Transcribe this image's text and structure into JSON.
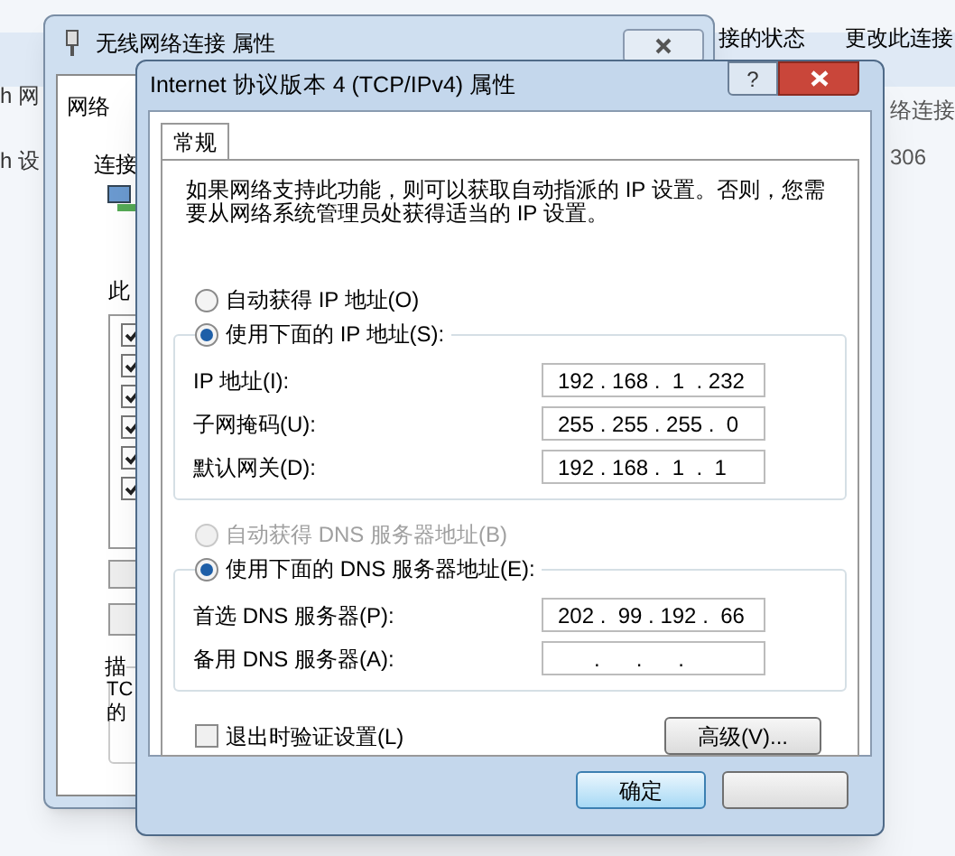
{
  "background": {
    "left_texts": [
      "h 网",
      "h 设"
    ],
    "right_texts": [
      "接的状态",
      "更改此连接"
    ],
    "right_lines": [
      "络连接",
      "306"
    ]
  },
  "back_dialog": {
    "title": "无线网络连接 属性",
    "tab": "网络",
    "labels": [
      "连接",
      "此"
    ],
    "items": [
      {
        "checked": true
      },
      {
        "checked": true
      },
      {
        "checked": true
      },
      {
        "checked": true
      },
      {
        "checked": true
      },
      {
        "checked": true
      }
    ],
    "group_title": "描",
    "group_lines": [
      "TC",
      "的"
    ]
  },
  "dialog": {
    "title": "Internet 协议版本 4 (TCP/IPv4) 属性",
    "help": "?",
    "tabs": [
      {
        "label": "常规",
        "selected": true
      }
    ],
    "description": "如果网络支持此功能，则可以获取自动指派的 IP 设置。否则，您需要从网络系统管理员处获得适当的 IP 设置。",
    "ip_modes": [
      {
        "label": "自动获得 IP 地址(O)",
        "selected": false,
        "disabled": false
      },
      {
        "label": "使用下面的 IP 地址(S):",
        "selected": true,
        "disabled": false
      }
    ],
    "ip_fields": [
      {
        "label": "IP 地址(I):",
        "value": "192 . 168 .  1  . 232"
      },
      {
        "label": "子网掩码(U):",
        "value": "255 . 255 . 255 .  0"
      },
      {
        "label": "默认网关(D):",
        "value": "192 . 168 .  1  .  1"
      }
    ],
    "dns_modes": [
      {
        "label": "自动获得 DNS 服务器地址(B)",
        "selected": false,
        "disabled": true
      },
      {
        "label": "使用下面的 DNS 服务器地址(E):",
        "selected": true,
        "disabled": false
      }
    ],
    "dns_fields": [
      {
        "label": "首选 DNS 服务器(P):",
        "value": "202 .  99 . 192 .  66"
      },
      {
        "label": "备用 DNS 服务器(A):",
        "value": "      .      .      ."
      }
    ],
    "validate": {
      "label": "退出时验证设置(L)",
      "checked": false
    },
    "advanced_button": "高级(V)...",
    "ok_button": "确定"
  }
}
